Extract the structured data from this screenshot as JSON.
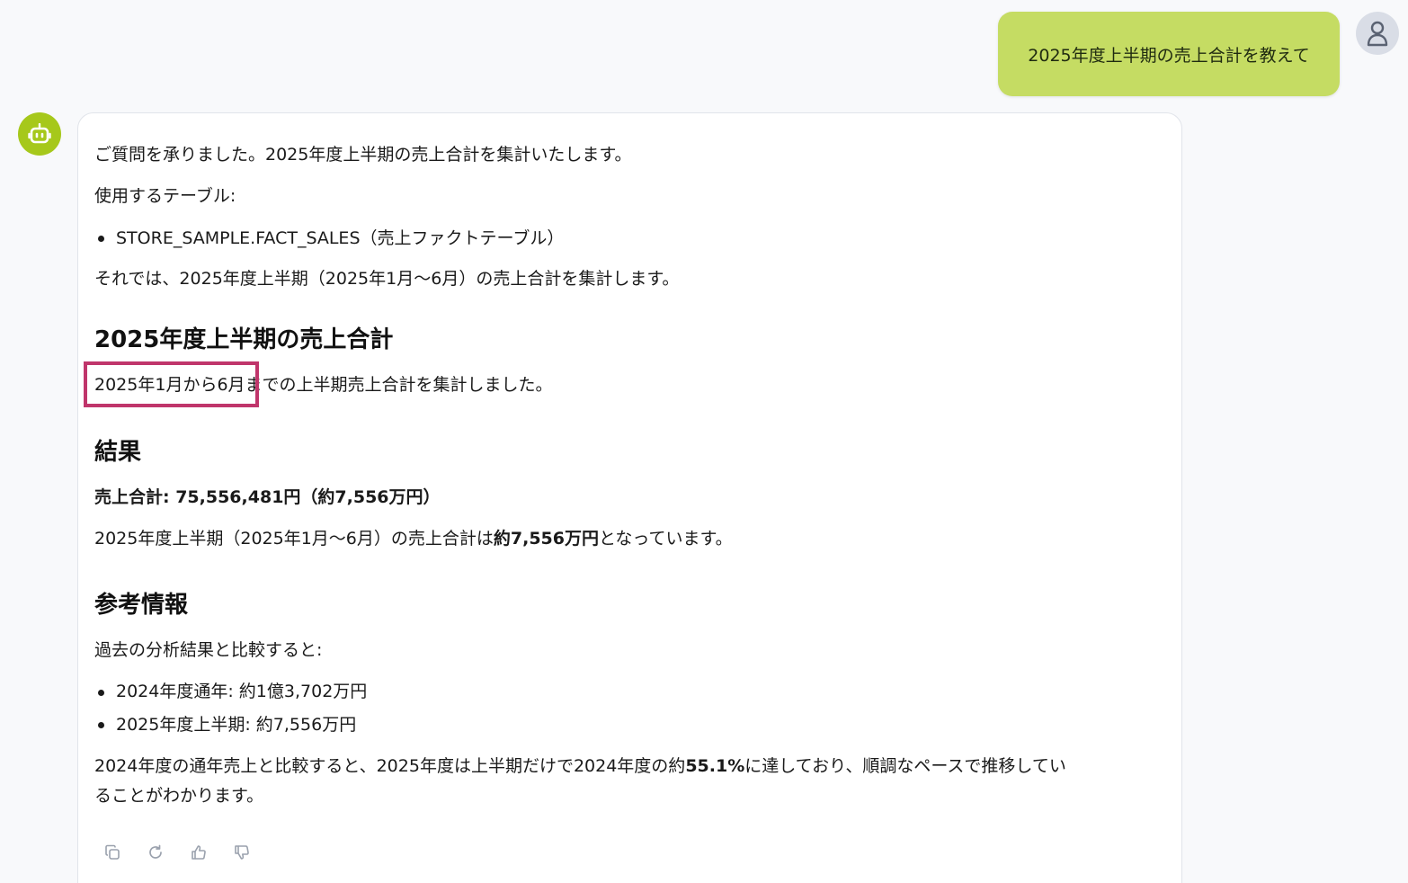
{
  "user_message": "2025年度上半期の売上合計を教えて",
  "bot": {
    "intro": "ご質問を承りました。2025年度上半期の売上合計を集計いたします。",
    "tables_label": "使用するテーブル:",
    "tables": [
      "STORE_SAMPLE.FACT_SALES（売上ファクトテーブル）"
    ],
    "lead": "それでは、2025年度上半期（2025年1月〜6月）の売上合計を集計します。",
    "section1": {
      "heading": "2025年度上半期の売上合計",
      "highlighted": "2025年1月から6月",
      "rest": "までの上半期売上合計を集計しました。"
    },
    "section2": {
      "heading": "結果",
      "total": "売上合計: 75,556,481円（約7,556万円）",
      "summary_pre": "2025年度上半期（2025年1月〜6月）の売上合計は",
      "summary_bold": "約7,556万円",
      "summary_post": "となっています。"
    },
    "section3": {
      "heading": "参考情報",
      "compare_label": "過去の分析結果と比較すると:",
      "items": [
        "2024年度通年: 約1億3,702万円",
        "2025年度上半期: 約7,556万円"
      ],
      "conclusion_pre": "2024年度の通年売上と比較すると、2025年度は上半期だけで2024年度の約",
      "conclusion_bold": "55.1%",
      "conclusion_post": "に達しており、順調なペースで推移してい",
      "conclusion_line2": "ることがわかります。"
    }
  },
  "actions": [
    "copy-icon",
    "regenerate-icon",
    "thumbs-up-icon",
    "thumbs-down-icon"
  ],
  "colors": {
    "user_bubble": "#c5dc63",
    "bot_avatar": "#a6c81b",
    "highlight": "#c0356b"
  }
}
